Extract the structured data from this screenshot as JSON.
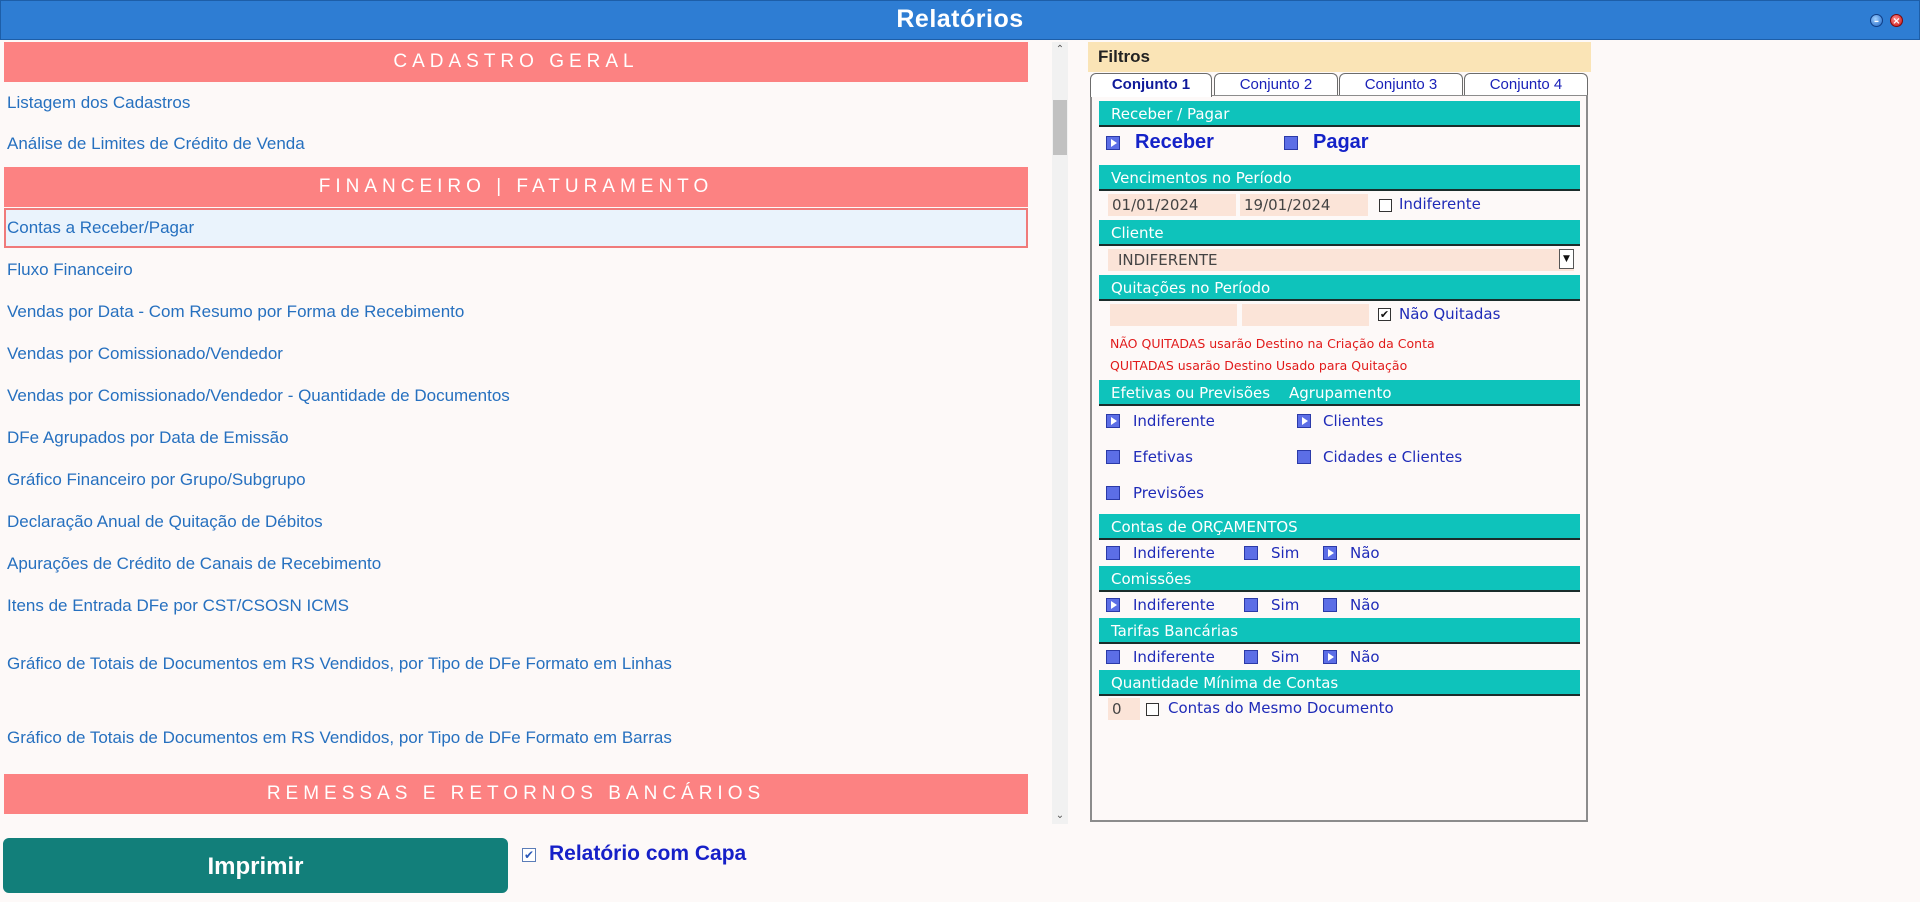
{
  "window": {
    "title": "Relatórios",
    "minimize_glyph": "–",
    "close_glyph": "×"
  },
  "reports": {
    "sections": [
      {
        "label": "CADASTRO GERAL"
      },
      {
        "label": "FINANCEIRO | FATURAMENTO"
      },
      {
        "label": "REMESSAS E RETORNOS BANCÁRIOS"
      }
    ],
    "items": [
      "Listagem dos Cadastros",
      "Análise de Limites de Crédito de Venda",
      "Contas a Receber/Pagar",
      "Fluxo Financeiro",
      "Vendas por Data - Com Resumo por Forma de Recebimento",
      "Vendas por Comissionado/Vendedor",
      "Vendas por Comissionado/Vendedor - Quantidade de Documentos",
      "DFe Agrupados por Data de Emissão",
      "Gráfico Financeiro por Grupo/Subgrupo",
      "Declaração Anual de Quitação de Débitos",
      "Apurações de Crédito de Canais de Recebimento",
      "Itens de Entrada DFe por CST/CSOSN ICMS",
      "Gráfico de Totais de Documentos em RS Vendidos, por Tipo de DFe Formato em Linhas",
      "Gráfico de Totais de Documentos em RS Vendidos, por Tipo de DFe Formato em Barras"
    ],
    "selected": "Contas a Receber/Pagar"
  },
  "footer": {
    "print_label": "Imprimir",
    "capa_label": "Relatório com Capa",
    "capa_checked": true,
    "check_glyph": "✔"
  },
  "filters": {
    "title": "Filtros",
    "tabs": [
      "Conjunto 1",
      "Conjunto 2",
      "Conjunto 3",
      "Conjunto 4"
    ],
    "active_tab": "Conjunto 1",
    "receber_pagar": {
      "label": "Receber / Pagar",
      "receber": "Receber",
      "pagar": "Pagar",
      "selected": "Receber"
    },
    "vencimentos": {
      "label": "Vencimentos no Período",
      "from": "01/01/2024",
      "to": "19/01/2024",
      "indiferente": "Indiferente",
      "indiferente_checked": false
    },
    "cliente": {
      "label": "Cliente",
      "value": "INDIFERENTE",
      "arrow": "▼"
    },
    "quitacoes": {
      "label": "Quitações no Período",
      "from": "",
      "to": "",
      "nao_quitadas": "Não Quitadas",
      "nao_quitadas_checked": true,
      "warning_1": "NÃO QUITADAS usarão Destino na Criação da Conta",
      "warning_2": "QUITADAS usarão Destino Usado para Quitação"
    },
    "efetivas": {
      "label": "Efetivas ou Previsões",
      "options": [
        "Indiferente",
        "Efetivas",
        "Previsões"
      ],
      "selected": "Indiferente"
    },
    "agrupamento": {
      "label": "Agrupamento",
      "options": [
        "Clientes",
        "Cidades e Clientes"
      ],
      "selected": "Clientes"
    },
    "orcamentos": {
      "label": "Contas de ORÇAMENTOS",
      "options": [
        "Indiferente",
        "Sim",
        "Não"
      ],
      "selected": "Não"
    },
    "comissoes": {
      "label": "Comissões",
      "options": [
        "Indiferente",
        "Sim",
        "Não"
      ],
      "selected": "Indiferente"
    },
    "tarifas": {
      "label": "Tarifas Bancárias",
      "options": [
        "Indiferente",
        "Sim",
        "Não"
      ],
      "selected": "Não"
    },
    "quantidade": {
      "label": "Quantidade Mínima de Contas",
      "value": "0",
      "mesmo_documento": "Contas do Mesmo Documento",
      "mesmo_documento_checked": false
    }
  }
}
